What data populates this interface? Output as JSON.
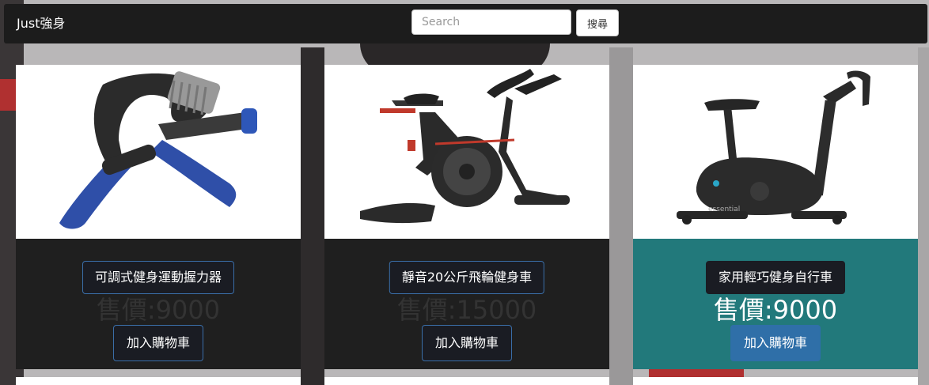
{
  "navbar": {
    "brand": "Just強身",
    "search_placeholder": "Search",
    "search_button": "搜尋"
  },
  "products": [
    {
      "name": "可調式健身運動握力器",
      "price": "售價:9000",
      "cart_label": "加入購物車",
      "image_icon": "hand-grip-icon"
    },
    {
      "name": "靜音20公斤飛輪健身車",
      "price": "售價:15000",
      "cart_label": "加入購物車",
      "image_icon": "spin-bike-icon"
    },
    {
      "name": "家用輕巧健身自行車",
      "price": "售價:9000",
      "cart_label": "加入購物車",
      "image_icon": "exercise-bike-icon"
    }
  ],
  "colors": {
    "navbar_bg": "#1c1c1c",
    "card_bg": "#1f1f1f",
    "card_highlight_bg": "#22797b",
    "button_bg": "#1a1c23",
    "button_border": "#3a6ea8",
    "active_button_bg": "#2f6fa8"
  }
}
